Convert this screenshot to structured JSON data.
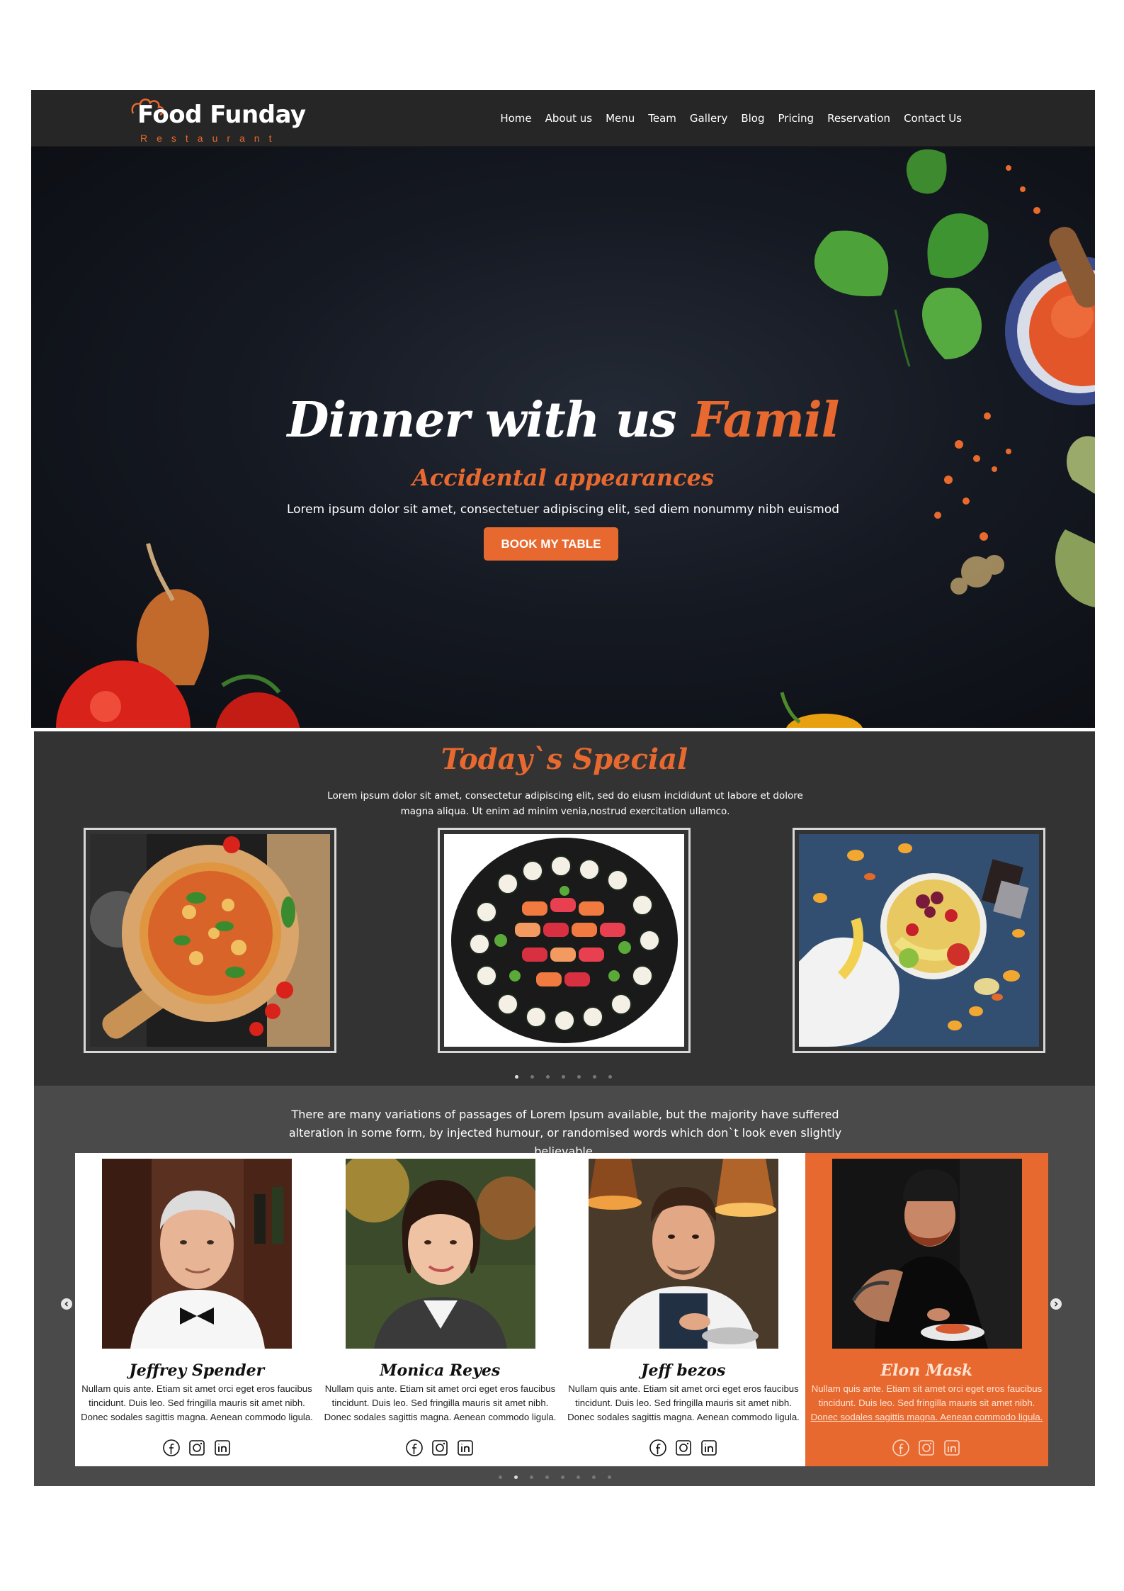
{
  "header": {
    "logo_main": "Food Funday",
    "logo_sub": "Restaurant",
    "nav": [
      "Home",
      "About us",
      "Menu",
      "Team",
      "Gallery",
      "Blog",
      "Pricing",
      "Reservation",
      "Contact Us"
    ]
  },
  "hero": {
    "title_white": "Dinner with us ",
    "title_accent": "Famil",
    "subtitle": "Accidental appearances",
    "text": "Lorem ipsum dolor sit amet, consectetuer adipiscing elit, sed diem nonummy nibh euismod",
    "button_label": "BOOK MY TABLE"
  },
  "special": {
    "title": "Today`s Special",
    "text": "Lorem ipsum dolor sit amet, consectetur adipiscing elit, sed do eiusm incididunt ut labore et dolore magna aliqua. Ut enim ad minim venia,nostrud exercitation ullamco.",
    "dishes": [
      "pizza-image",
      "sushi-platter-image",
      "fruit-bowl-image"
    ],
    "slides": 7,
    "active_slide": 1
  },
  "team": {
    "text": "There are many variations of passages of Lorem Ipsum available, but the majority have suffered alteration in some form, by injected humour, or randomised words which don`t look even slightly believable.",
    "members": [
      {
        "name": "Jeffrey Spender",
        "bio_lines": [
          "Nullam quis ante. Etiam sit amet orci eget eros faucibus",
          "tincidunt. Duis leo. Sed fringilla mauris sit amet nibh.",
          "Donec sodales sagittis magna. Aenean commodo ligula."
        ]
      },
      {
        "name": "Monica Reyes",
        "bio_lines": [
          "Nullam quis ante. Etiam sit amet orci eget eros faucibus",
          "tincidunt. Duis leo. Sed fringilla mauris sit amet nibh.",
          "Donec sodales sagittis magna. Aenean commodo ligula."
        ]
      },
      {
        "name": "Jeff bezos",
        "bio_lines": [
          "Nullam quis ante. Etiam sit amet orci eget eros faucibus",
          "tincidunt. Duis leo. Sed fringilla mauris sit amet nibh.",
          "Donec sodales sagittis magna. Aenean commodo ligula."
        ]
      },
      {
        "name": "Elon Mask",
        "bio_lines": [
          "Nullam quis ante. Etiam sit amet orci eget eros faucibus",
          "tincidunt. Duis leo. Sed fringilla mauris sit amet nibh.",
          "Donec sodales sagittis magna. Aenean commodo ligula."
        ]
      }
    ],
    "social_icons": [
      "facebook-icon",
      "instagram-icon",
      "linkedin-icon"
    ],
    "slides": 8,
    "active_slide": 2
  },
  "colors": {
    "accent": "#e8692f",
    "header_bg": "#262626",
    "special_bg": "#333333",
    "team_bg": "#4a4a4a"
  }
}
